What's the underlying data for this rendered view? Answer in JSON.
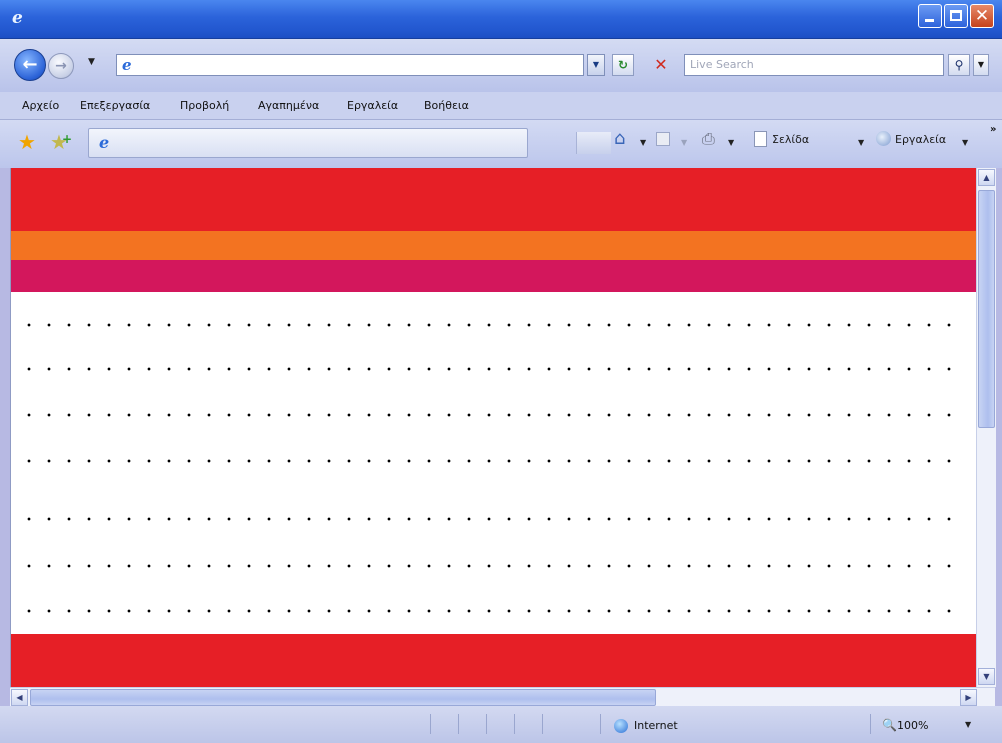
{
  "window": {
    "title": ""
  },
  "address": {
    "url": "",
    "search_placeholder": "Live Search"
  },
  "menu": {
    "items": [
      "Αρχείο",
      "Επεξεργασία",
      "Προβολή",
      "Αγαπημένα",
      "Εργαλεία",
      "Βοήθεια"
    ]
  },
  "command_bar": {
    "tab_title": "",
    "page_label": "Σελίδα",
    "tools_label": "Εργαλεία"
  },
  "status": {
    "zone": "Internet",
    "zoom": "100%"
  },
  "page": {
    "dotted_lines": 7,
    "colors": {
      "red": "#e61f26",
      "orange": "#f37321",
      "magenta": "#d3175c"
    }
  },
  "icons": [
    "ie-logo-icon",
    "back-icon",
    "forward-icon",
    "refresh-icon",
    "stop-icon",
    "search-icon",
    "favorites-star-icon",
    "add-favorites-icon",
    "home-icon",
    "feeds-icon",
    "print-icon",
    "page-icon",
    "tools-icon",
    "internet-zone-icon",
    "zoom-icon"
  ]
}
